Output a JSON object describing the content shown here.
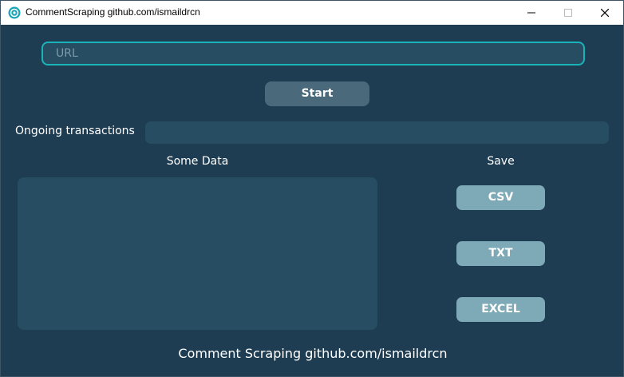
{
  "window": {
    "title": "CommentScraping github.com/ismaildrcn",
    "icon": "app-logo-icon",
    "controls": [
      "minimize-icon",
      "maximize-icon",
      "close-icon"
    ]
  },
  "url_field": {
    "placeholder": "URL",
    "value": ""
  },
  "start_button": {
    "label": "Start"
  },
  "progress": {
    "label": "Ongoing transactions",
    "value": 0
  },
  "data_panel": {
    "label": "Some Data",
    "content": ""
  },
  "save_panel": {
    "label": "Save",
    "buttons": [
      "CSV",
      "TXT",
      "EXCEL"
    ]
  },
  "footer": {
    "text": "Comment Scraping github.com/ismaildrcn"
  },
  "colors": {
    "background": "#1e3d52",
    "panel": "#274d63",
    "accent_border": "#1ab3b8",
    "start_button": "#4a6a7c",
    "save_button": "#7ea9b6"
  }
}
